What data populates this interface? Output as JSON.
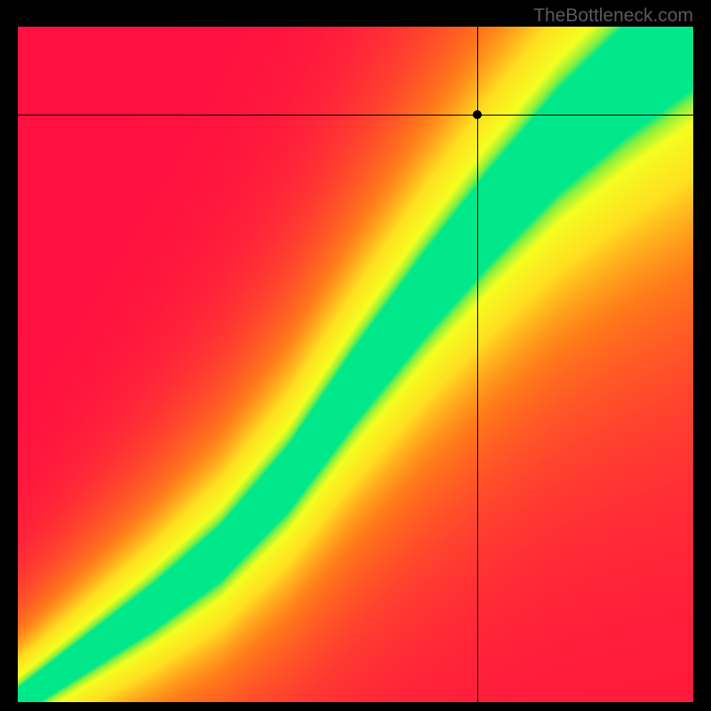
{
  "watermark": "TheBottleneck.com",
  "chart_data": {
    "type": "heatmap",
    "title": "",
    "xlabel": "",
    "ylabel": "",
    "xlim": [
      0,
      100
    ],
    "ylim": [
      0,
      100
    ],
    "crosshair": {
      "x": 68,
      "y": 87
    },
    "optimal_curve": [
      {
        "x": 0,
        "y": 0
      },
      {
        "x": 10,
        "y": 7
      },
      {
        "x": 20,
        "y": 14
      },
      {
        "x": 30,
        "y": 22
      },
      {
        "x": 40,
        "y": 33
      },
      {
        "x": 50,
        "y": 47
      },
      {
        "x": 60,
        "y": 60
      },
      {
        "x": 70,
        "y": 72
      },
      {
        "x": 80,
        "y": 83
      },
      {
        "x": 90,
        "y": 92
      },
      {
        "x": 100,
        "y": 100
      }
    ],
    "color_stops": [
      {
        "offset": 0.0,
        "color": "#ff1040"
      },
      {
        "offset": 0.35,
        "color": "#ff7a1a"
      },
      {
        "offset": 0.6,
        "color": "#ffe020"
      },
      {
        "offset": 0.82,
        "color": "#f4ff20"
      },
      {
        "offset": 0.93,
        "color": "#86f040"
      },
      {
        "offset": 1.0,
        "color": "#00e88a"
      }
    ],
    "grid": false,
    "legend": false
  }
}
